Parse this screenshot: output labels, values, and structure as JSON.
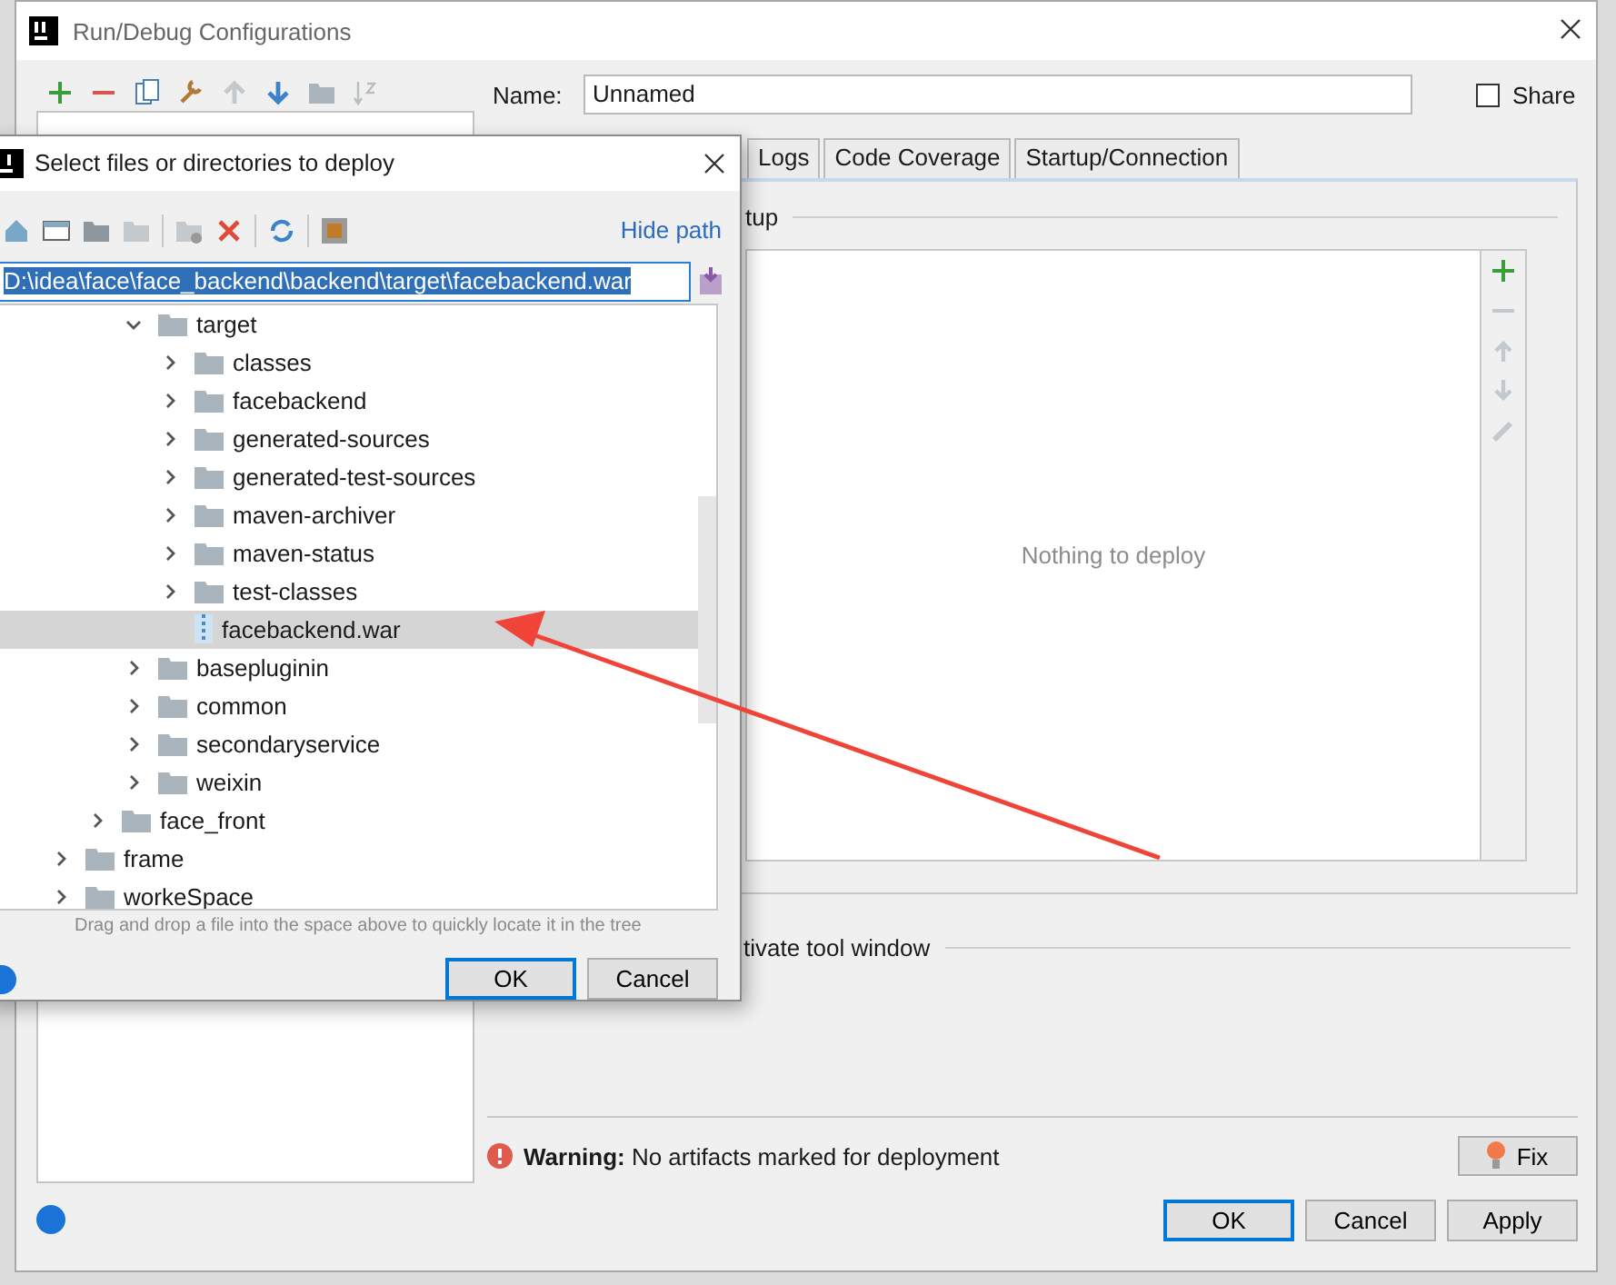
{
  "window": {
    "title": "Run/Debug Configurations"
  },
  "name_field": {
    "label": "Name:",
    "value": "Unnamed"
  },
  "share": {
    "label": "Share",
    "checked": false
  },
  "tabs": [
    {
      "label": "Logs",
      "selected": false
    },
    {
      "label": "Code Coverage",
      "selected": false
    },
    {
      "label": "Startup/Connection",
      "selected": false
    }
  ],
  "deploy_group": {
    "title": "tup",
    "empty_text": "Nothing to deploy"
  },
  "activate_group": {
    "title": "tivate tool window"
  },
  "warning": {
    "message": "**Warning:** No artifacts marked for deployment",
    "fix": "Fix"
  },
  "buttons": [
    {
      "label": "OK",
      "default": true
    },
    {
      "label": "Cancel",
      "default": false
    },
    {
      "label": "Apply",
      "default": false
    }
  ],
  "file_dialog": {
    "title": "Select files or directories to deploy",
    "hide_path": "Hide path",
    "path": "D:\\idea\\face\\face_backend\\backend\\target\\facebackend.war",
    "tree": [
      {
        "children": [
          {
            "children": [
              {
                "kind": "folder",
                "label": "target",
                "expanded": true,
                "selected": false,
                "children": [
                  {
                    "kind": "folder",
                    "label": "classes",
                    "expanded": false,
                    "selected": false
                  },
                  {
                    "kind": "folder",
                    "label": "facebackend",
                    "expanded": false,
                    "selected": false
                  },
                  {
                    "kind": "folder",
                    "label": "generated-sources",
                    "expanded": false,
                    "selected": false
                  },
                  {
                    "kind": "folder",
                    "label": "generated-test-sources",
                    "expanded": false,
                    "selected": false
                  },
                  {
                    "kind": "folder",
                    "label": "maven-archiver",
                    "expanded": false,
                    "selected": false
                  },
                  {
                    "kind": "folder",
                    "label": "maven-status",
                    "expanded": false,
                    "selected": false
                  },
                  {
                    "kind": "folder",
                    "label": "test-classes",
                    "expanded": false,
                    "selected": false
                  },
                  {
                    "kind": "file",
                    "label": "facebackend.war",
                    "selected": true
                  }
                ]
              },
              {
                "kind": "folder",
                "label": "basepluginin",
                "expanded": false,
                "selected": false
              },
              {
                "kind": "folder",
                "label": "common",
                "expanded": false,
                "selected": false
              },
              {
                "kind": "folder",
                "label": "secondaryservice",
                "expanded": false,
                "selected": false
              },
              {
                "kind": "folder",
                "label": "weixin",
                "expanded": false,
                "selected": false
              }
            ]
          },
          {
            "kind": "folder",
            "label": "face_front",
            "expanded": false,
            "selected": false
          }
        ]
      },
      {
        "kind": "folder",
        "label": "frame",
        "expanded": false,
        "selected": false
      },
      {
        "kind": "folder",
        "label": "workeSpace",
        "expanded": false,
        "selected": false
      }
    ],
    "hint": "Drag and drop a file into the space above to quickly locate it in the tree",
    "buttons": [
      {
        "label": "OK",
        "default": true
      },
      {
        "label": "Cancel",
        "default": false
      }
    ]
  }
}
